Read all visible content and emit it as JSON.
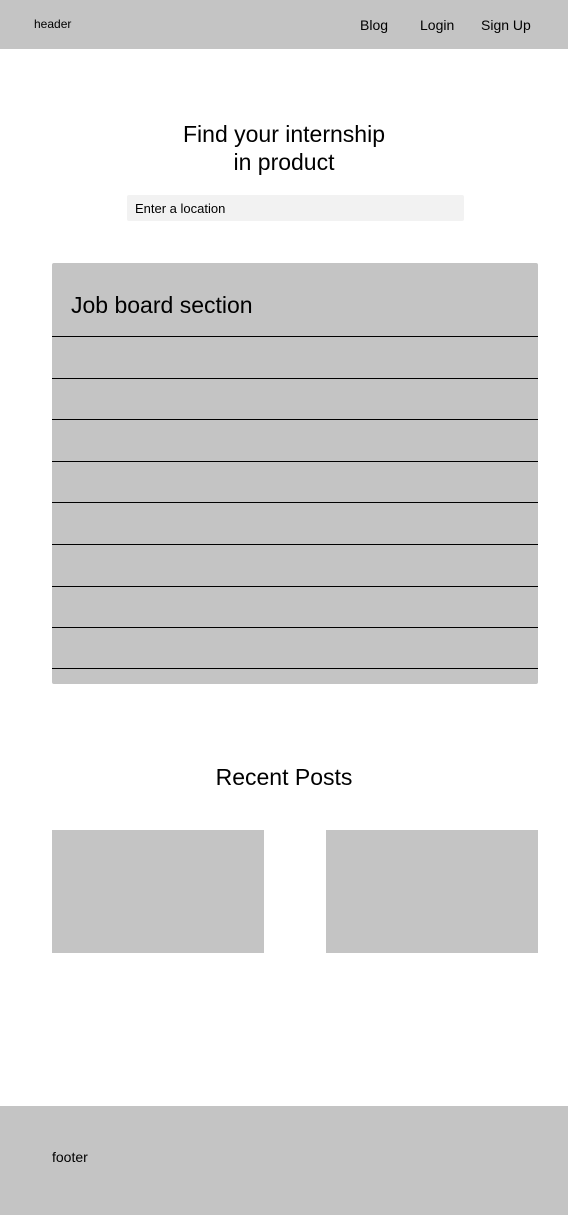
{
  "header": {
    "label": "header",
    "nav": {
      "blog": "Blog",
      "login": "Login",
      "signup": "Sign Up"
    }
  },
  "hero": {
    "title_line1": "Find your internship",
    "title_line2": "in product",
    "location_placeholder": "Enter a location"
  },
  "job_board": {
    "title": "Job board section",
    "rows": [
      "",
      "",
      "",
      "",
      "",
      "",
      "",
      ""
    ]
  },
  "recent_posts": {
    "title": "Recent Posts"
  },
  "footer": {
    "label": "footer"
  },
  "colors": {
    "placeholder_gray": "#c4c4c4",
    "input_bg": "#f2f2f2",
    "divider": "#000000"
  }
}
